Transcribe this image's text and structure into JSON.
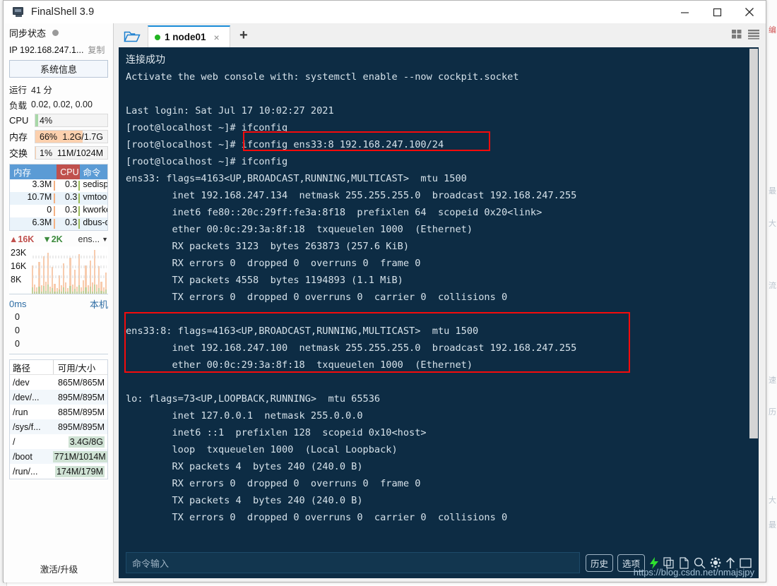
{
  "window": {
    "title": "FinalShell 3.9",
    "app_icon": "monitor-icon",
    "minimize": "—",
    "maximize": "□",
    "close": "✕"
  },
  "sidebar": {
    "sync_label": "同步状态",
    "ip_label": "IP 192.168.247.1...",
    "copy_label": "复制",
    "sysinfo_button": "系统信息",
    "uptime": {
      "key": "运行",
      "value": "41 分"
    },
    "load": {
      "key": "负载",
      "value": "0.02, 0.02, 0.00"
    },
    "stats": [
      {
        "key": "CPU",
        "text": "4%",
        "right": "",
        "percent": 4,
        "color": "#a8d8a8"
      },
      {
        "key": "内存",
        "text": "66%",
        "right": "1.2G/1.7G",
        "percent": 66,
        "color": "#fbd0ae"
      },
      {
        "key": "交换",
        "text": "1%",
        "right": "11M/1024M",
        "percent": 1,
        "color": "#fbd0ae"
      }
    ],
    "proc_table": {
      "headers": [
        "内存",
        "CPU",
        "命令"
      ],
      "rows": [
        [
          "3.3M",
          "0.3",
          "sedispat"
        ],
        [
          "10.7M",
          "0.3",
          "vmtools"
        ],
        [
          "0",
          "0.3",
          "kworker"
        ],
        [
          "6.3M",
          "0.3",
          "dbus-da"
        ]
      ]
    },
    "network": {
      "up_label": "16K",
      "down_label": "2K",
      "interface": "ens...",
      "y_labels": [
        "23K",
        "16K",
        "8K"
      ],
      "bars": [
        62,
        20,
        14,
        70,
        18,
        82,
        26,
        90,
        16,
        58,
        22,
        13,
        40,
        18,
        66,
        24,
        12,
        78,
        20,
        52,
        16,
        86,
        14,
        30,
        62,
        18,
        72,
        24,
        96,
        20,
        60,
        26,
        14,
        46
      ]
    },
    "latency": {
      "ms_label": "0ms",
      "host_label": "本机",
      "y_labels": [
        "0",
        "0",
        "0"
      ]
    },
    "disk_table": {
      "headers": [
        "路径",
        "可用/大小"
      ],
      "rows": [
        {
          "path": "/dev",
          "size": "865M/865M",
          "highlight": false
        },
        {
          "path": "/dev/...",
          "size": "895M/895M",
          "highlight": false
        },
        {
          "path": "/run",
          "size": "885M/895M",
          "highlight": false
        },
        {
          "path": "/sys/f...",
          "size": "895M/895M",
          "highlight": false
        },
        {
          "path": "/",
          "size": "3.4G/8G",
          "highlight": true
        },
        {
          "path": "/boot",
          "size": "771M/1014M",
          "highlight": true
        },
        {
          "path": "/run/...",
          "size": "174M/179M",
          "highlight": true
        }
      ]
    },
    "activate_label": "激活/升级"
  },
  "tabbar": {
    "folder_icon": "open-folder-icon",
    "tab": {
      "index": "1",
      "name": "node01",
      "close": "×"
    },
    "add_label": "+",
    "grid_icon": "grid-view-icon",
    "list_icon": "list-view-icon"
  },
  "terminal": {
    "connect_msg": "连接成功",
    "lines": [
      "Activate the web console with: systemctl enable --now cockpit.socket",
      "",
      "Last login: Sat Jul 17 10:02:27 2021",
      "[root@localhost ~]# ifconfig",
      "[root@localhost ~]# ifconfig ens33:8 192.168.247.100/24",
      "[root@localhost ~]# ifconfig",
      "ens33: flags=4163<UP,BROADCAST,RUNNING,MULTICAST>  mtu 1500",
      "        inet 192.168.247.134  netmask 255.255.255.0  broadcast 192.168.247.255",
      "        inet6 fe80::20c:29ff:fe3a:8f18  prefixlen 64  scopeid 0x20<link>",
      "        ether 00:0c:29:3a:8f:18  txqueuelen 1000  (Ethernet)",
      "        RX packets 3123  bytes 263873 (257.6 KiB)",
      "        RX errors 0  dropped 0  overruns 0  frame 0",
      "        TX packets 4558  bytes 1194893 (1.1 MiB)",
      "        TX errors 0  dropped 0 overruns 0  carrier 0  collisions 0",
      "",
      "ens33:8: flags=4163<UP,BROADCAST,RUNNING,MULTICAST>  mtu 1500",
      "        inet 192.168.247.100  netmask 255.255.255.0  broadcast 192.168.247.255",
      "        ether 00:0c:29:3a:8f:18  txqueuelen 1000  (Ethernet)",
      "",
      "lo: flags=73<UP,LOOPBACK,RUNNING>  mtu 65536",
      "        inet 127.0.0.1  netmask 255.0.0.0",
      "        inet6 ::1  prefixlen 128  scopeid 0x10<host>",
      "        loop  txqueuelen 1000  (Local Loopback)",
      "        RX packets 4  bytes 240 (240.0 B)",
      "        RX errors 0  dropped 0  overruns 0  frame 0",
      "        TX packets 4  bytes 240 (240.0 B)",
      "        TX errors 0  dropped 0 overruns 0  carrier 0  collisions 0"
    ],
    "highlight_color": "#f50b0b",
    "background": "#0d2c44"
  },
  "command_bar": {
    "placeholder": "命令输入",
    "history_label": "历史",
    "options_label": "选项",
    "icons": [
      "lightning-icon",
      "copy-icon",
      "paste-icon",
      "search-icon",
      "gear-icon",
      "upload-icon",
      "window-icon"
    ]
  },
  "watermark": "https://blog.csdn.net/nmajsjpy",
  "background_ghost": {
    "right_items": [
      "最",
      "大",
      "流",
      "速",
      "历",
      "大",
      "最"
    ],
    "red_item": "编"
  }
}
